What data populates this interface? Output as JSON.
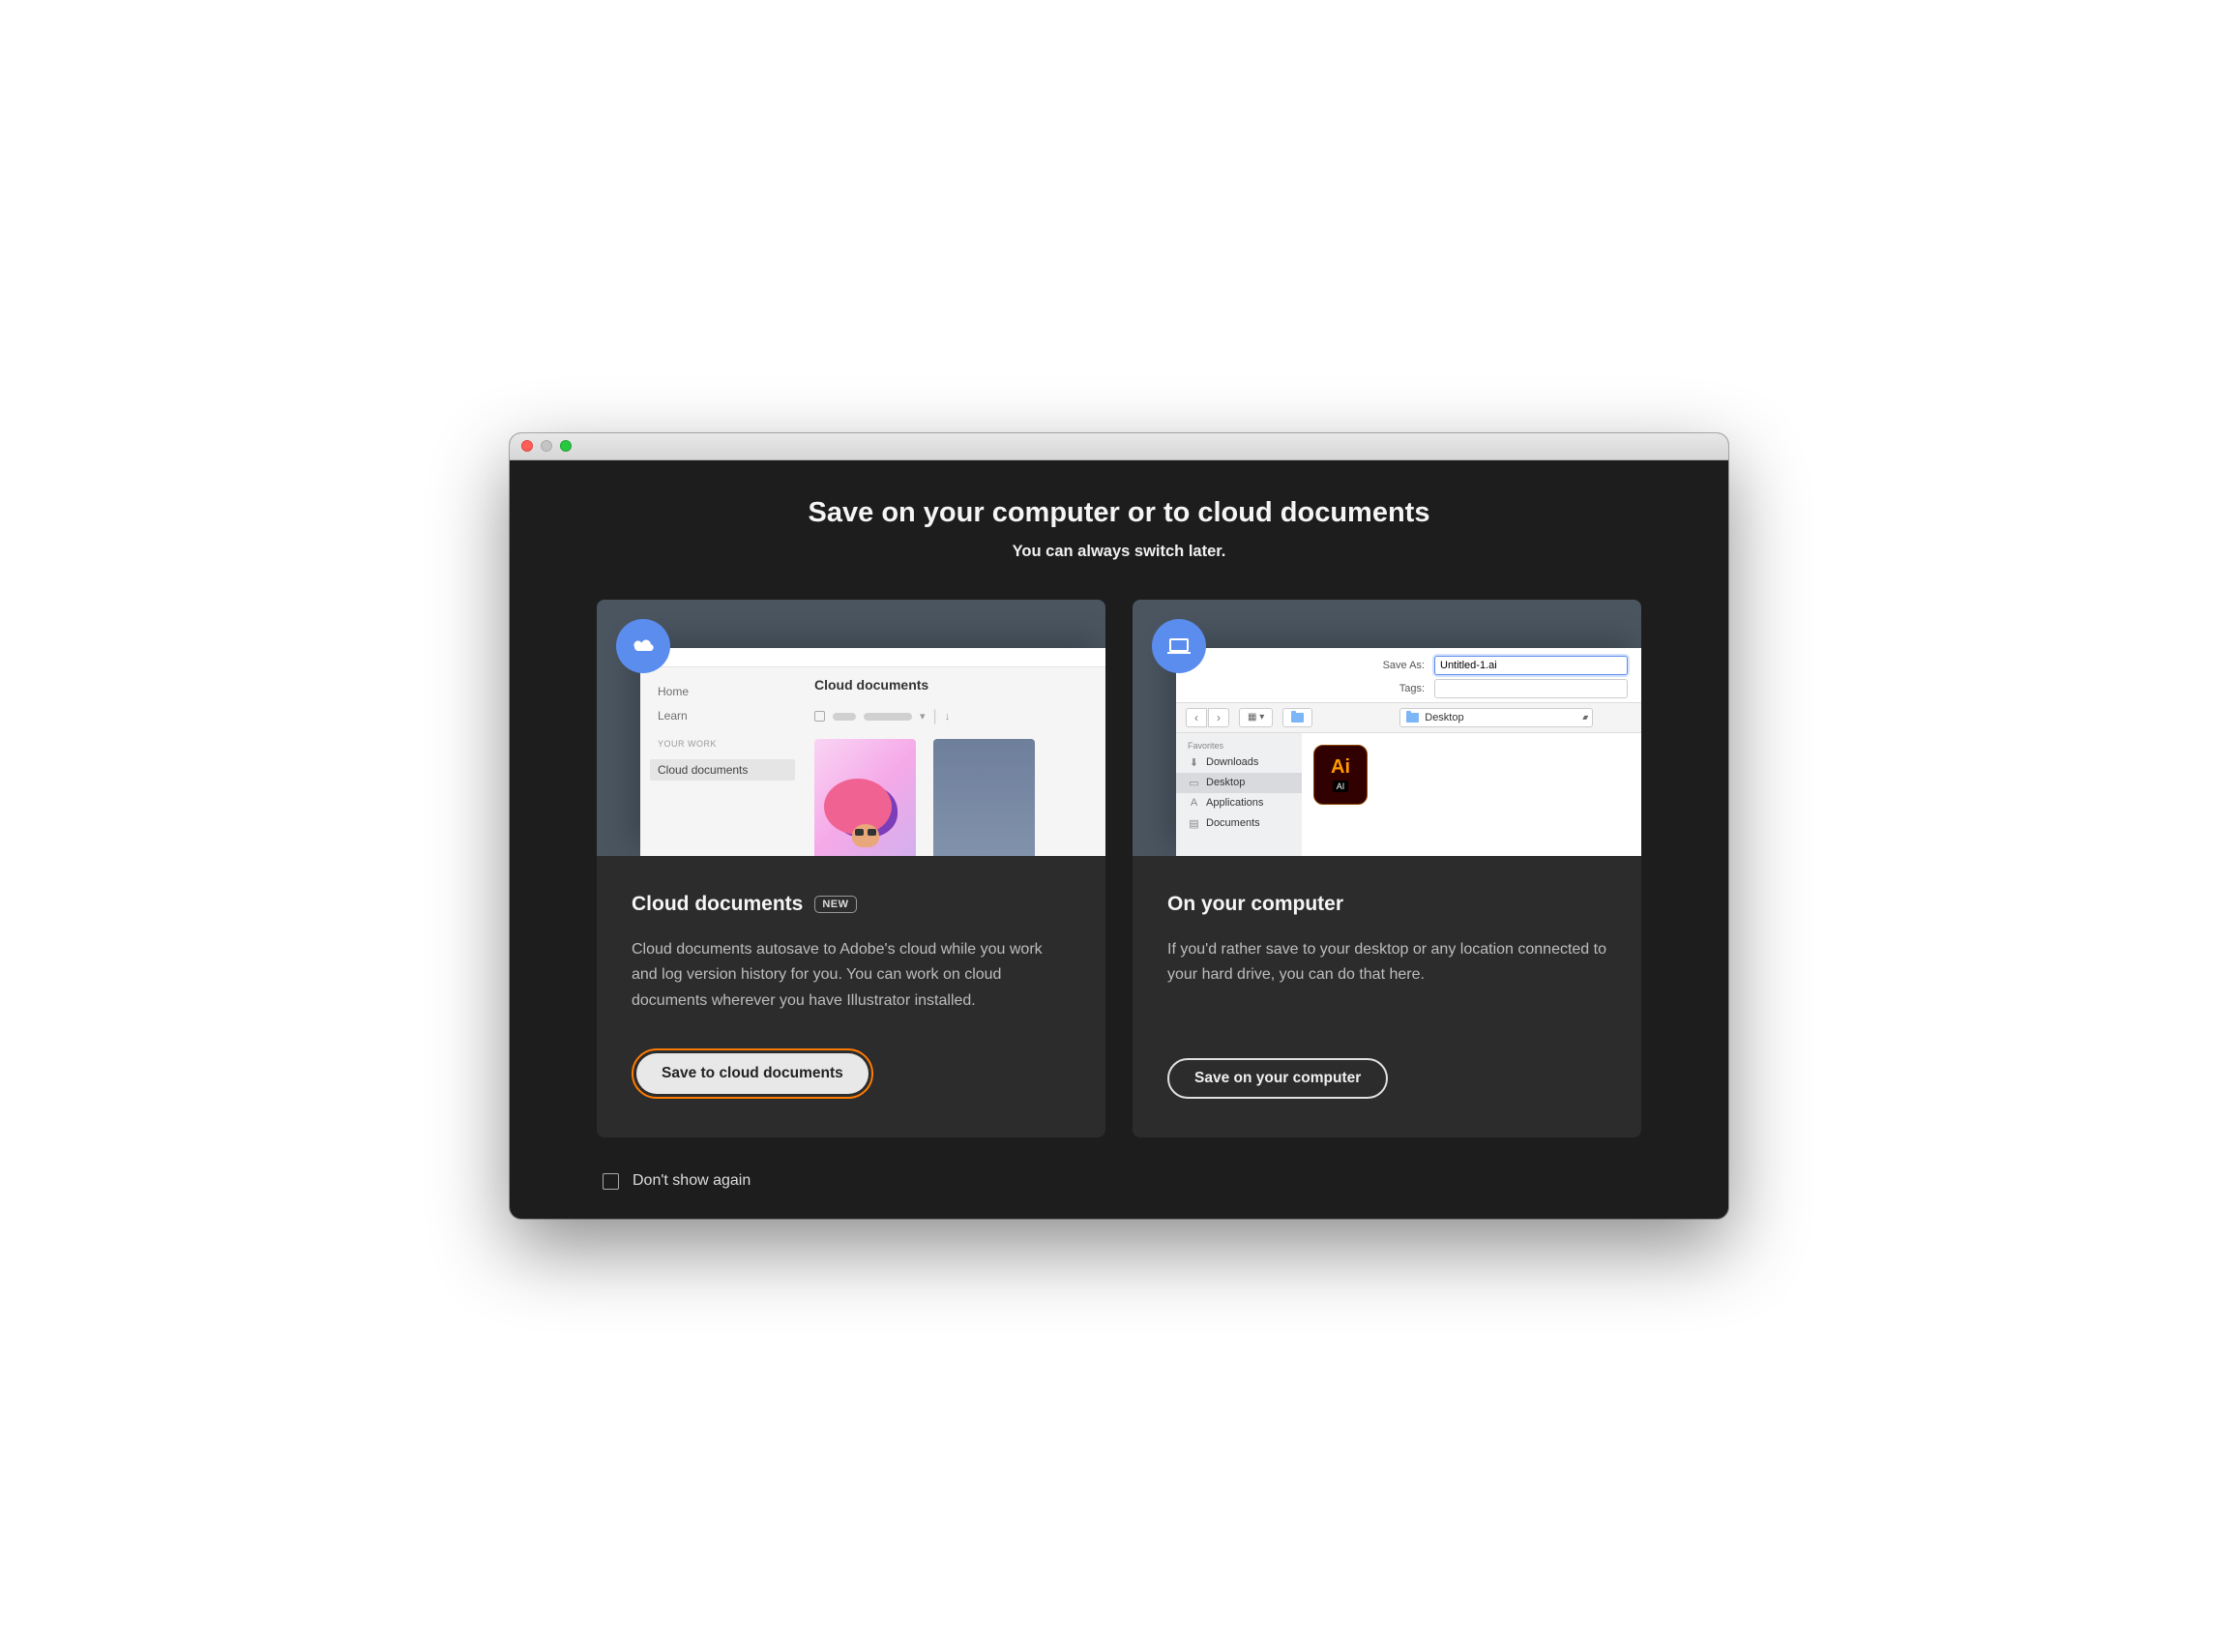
{
  "dialog": {
    "title": "Save on your computer or to cloud documents",
    "subtitle": "You can always switch later."
  },
  "cloud_card": {
    "title": "Cloud documents",
    "badge": "NEW",
    "description": "Cloud documents autosave to Adobe's cloud while you work and log version history for you. You can work on cloud documents wherever you have Illustrator installed.",
    "button": "Save to cloud documents",
    "preview": {
      "nav": {
        "home": "Home",
        "learn": "Learn",
        "section": "YOUR WORK",
        "cloud_docs": "Cloud documents"
      },
      "panel_title": "Cloud documents"
    }
  },
  "computer_card": {
    "title": "On your computer",
    "description": "If you'd rather save to your desktop or any location connected to your hard drive, you can do that here.",
    "button": "Save on your computer",
    "preview": {
      "save_as_label": "Save As:",
      "save_as_value": "Untitled-1.ai",
      "tags_label": "Tags:",
      "location": "Desktop",
      "sidebar_header": "Favorites",
      "sidebar": {
        "downloads": "Downloads",
        "desktop": "Desktop",
        "applications": "Applications",
        "documents": "Documents"
      },
      "file_icon": {
        "big": "Ai",
        "small": "AI"
      }
    }
  },
  "footer": {
    "dont_show_label": "Don't show again"
  }
}
